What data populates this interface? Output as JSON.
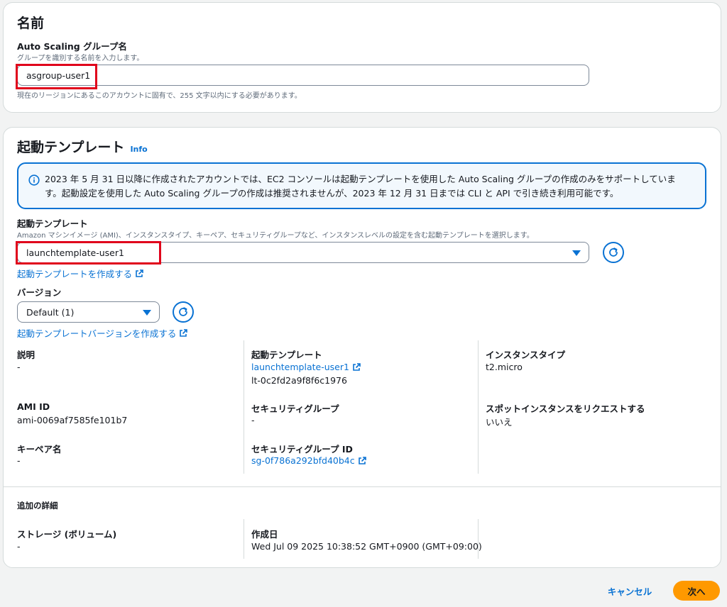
{
  "name_section": {
    "title": "名前",
    "field_label": "Auto Scaling グループ名",
    "field_hint": "グループを識別する名前を入力します。",
    "field_value": "asgroup-user1",
    "field_constraint": "現在のリージョンにあるこのアカウントに固有で、255 文字以内にする必要があります。"
  },
  "template_section": {
    "title": "起動テンプレート",
    "info_link": "Info",
    "alert_text": "2023 年 5 月 31 日以降に作成されたアカウントでは、EC2 コンソールは起動テンプレートを使用した Auto Scaling グループの作成のみをサポートしています。起動設定を使用した Auto Scaling グループの作成は推奨されませんが、2023 年 12 月 31 日までは CLI と API で引き続き利用可能です。",
    "template_label": "起動テンプレート",
    "template_hint": "Amazon マシンイメージ (AMI)、インスタンスタイプ、キーペア、セキュリティグループなど、インスタンスレベルの設定を含む起動テンプレートを選択します。",
    "template_value": "launchtemplate-user1",
    "create_template_link": "起動テンプレートを作成する",
    "version_label": "バージョン",
    "version_value": "Default (1)",
    "create_version_link": "起動テンプレートバージョンを作成する"
  },
  "details": {
    "description_label": "説明",
    "description_value": "-",
    "launch_template_label": "起動テンプレート",
    "launch_template_link": "launchtemplate-user1",
    "launch_template_id": "lt-0c2fd2a9f8f6c1976",
    "instance_type_label": "インスタンスタイプ",
    "instance_type_value": "t2.micro",
    "ami_id_label": "AMI ID",
    "ami_id_value": "ami-0069af7585fe101b7",
    "security_group_label": "セキュリティグループ",
    "security_group_value": "-",
    "spot_label": "スポットインスタンスをリクエストする",
    "spot_value": "いいえ",
    "key_pair_label": "キーペア名",
    "key_pair_value": "-",
    "security_group_id_label": "セキュリティグループ ID",
    "security_group_id_link": "sg-0f786a292bfd40b4c"
  },
  "additional": {
    "title": "追加の詳細",
    "storage_label": "ストレージ (ボリューム)",
    "storage_value": "-",
    "created_label": "作成日",
    "created_value": "Wed Jul 09 2025 10:38:52 GMT+0900 (GMT+09:00)"
  },
  "footer": {
    "cancel_label": "キャンセル",
    "next_label": "次へ"
  },
  "colors": {
    "accent": "#0972d3",
    "primary_button": "#ff9900",
    "highlight_box": "#e0001b"
  }
}
